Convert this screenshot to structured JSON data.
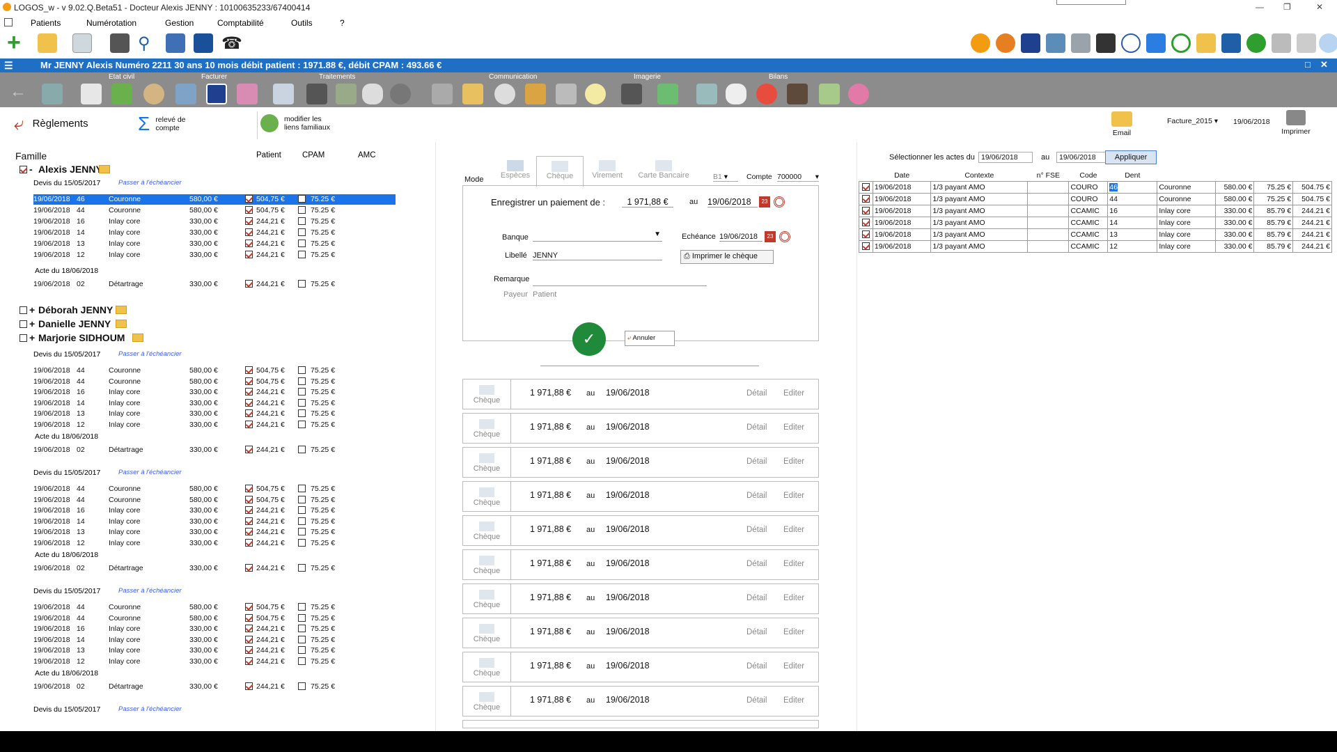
{
  "window": {
    "title": "LOGOS_w - v 9.02.Q.Beta51  -  Docteur Alexis JENNY : 10100635233/67400414"
  },
  "menu": [
    "Patients",
    "Numérotation",
    "Gestion",
    "Comptabilité",
    "Outils",
    "?"
  ],
  "patient_bar": "Mr JENNY Alexis   Numéro 2211    30 ans 10 mois   débit patient : 1971.88 €, débit CPAM : 493.66 €",
  "group_labels": {
    "etat_civil": "Etat civil",
    "facturer": "Facturer",
    "traitements": "Traitements",
    "communication": "Communication",
    "imagerie": "Imagerie",
    "bilans": "Bilans"
  },
  "actions": {
    "reglements": "Règlements",
    "releve": "relevé de compte",
    "modifier": "modifier les liens familiaux",
    "email": "Email",
    "facture_select": "Facture_2015",
    "facture_date": "19/06/2018",
    "imprimer": "Imprimer"
  },
  "left": {
    "headers": {
      "famille": "Famille",
      "patient": "Patient",
      "cpam": "CPAM",
      "amc": "AMC"
    },
    "members": [
      {
        "label": "Alexis JENNY",
        "prefix": "-"
      },
      {
        "label": "Déborah JENNY",
        "prefix": "+"
      },
      {
        "label": "Danielle JENNY",
        "prefix": "+"
      },
      {
        "label": "Marjorie SIDHOUM",
        "prefix": "+"
      }
    ],
    "devis_label": "Devis du 15/05/2017",
    "echeancier": "Passer à l'échéancier",
    "acte_label": "Acte du 18/06/2018",
    "group1_rows": [
      [
        "19/06/2018",
        "46",
        "Couronne",
        "580,00 €",
        "504,75 €",
        "75.25 €"
      ],
      [
        "19/06/2018",
        "44",
        "Couronne",
        "580,00 €",
        "504,75 €",
        "75.25 €"
      ],
      [
        "19/06/2018",
        "16",
        "Inlay core",
        "330,00 €",
        "244,21 €",
        "75.25 €"
      ],
      [
        "19/06/2018",
        "14",
        "Inlay core",
        "330,00 €",
        "244,21 €",
        "75.25 €"
      ],
      [
        "19/06/2018",
        "13",
        "Inlay core",
        "330,00 €",
        "244,21 €",
        "75.25 €"
      ],
      [
        "19/06/2018",
        "12",
        "Inlay core",
        "330,00 €",
        "244,21 €",
        "75.25 €"
      ]
    ],
    "group2_rows": [
      [
        "19/06/2018",
        "44",
        "Couronne",
        "580,00 €",
        "504,75 €",
        "75.25 €"
      ],
      [
        "19/06/2018",
        "44",
        "Couronne",
        "580,00 €",
        "504,75 €",
        "75.25 €"
      ],
      [
        "19/06/2018",
        "16",
        "Inlay core",
        "330,00 €",
        "244,21 €",
        "75.25 €"
      ],
      [
        "19/06/2018",
        "14",
        "Inlay core",
        "330,00 €",
        "244,21 €",
        "75.25 €"
      ],
      [
        "19/06/2018",
        "13",
        "Inlay core",
        "330,00 €",
        "244,21 €",
        "75.25 €"
      ],
      [
        "19/06/2018",
        "12",
        "Inlay core",
        "330,00 €",
        "244,21 €",
        "75.25 €"
      ]
    ],
    "acte_row": [
      "19/06/2018",
      "02",
      "Détartrage",
      "330,00 €",
      "244,21 €",
      "75.25 €"
    ]
  },
  "payment": {
    "tabs": [
      "Mode",
      "Espèces",
      "Chèque",
      "Virement",
      "Carte Bancaire"
    ],
    "b1": "B1",
    "compte_label": "Compte",
    "compte_value": "700000",
    "title": "Enregistrer un paiement de :",
    "amount": "1 971,88 €",
    "au": "au",
    "date": "19/06/2018",
    "banque_label": "Banque",
    "echeance_label": "Echéance",
    "echeance_value": "19/06/2018",
    "libelle_label": "Libellé",
    "libelle_value": "JENNY",
    "imprimer_cheque": "Imprimer le chèque",
    "remarque_label": "Remarque",
    "payeur_label": "Payeur",
    "payeur_value": "Patient",
    "annuler": "Annuler",
    "history": {
      "mode": "Chèque",
      "amount": "1 971,88 €",
      "au": "au",
      "date": "19/06/2018",
      "detail": "Détail",
      "editer": "Editer",
      "count": 10
    }
  },
  "right": {
    "select_label": "Sélectionner les actes du",
    "from": "19/06/2018",
    "au": "au",
    "to": "19/06/2018",
    "apply": "Appliquer",
    "columns": [
      "Date",
      "Contexte",
      "n° FSE",
      "Code",
      "Dent"
    ],
    "rows": [
      [
        "19/06/2018",
        "1/3 payant AMO",
        "",
        "COURO",
        "46",
        "Couronne",
        "580.00 €",
        "75.25 €",
        "504.75 €"
      ],
      [
        "19/06/2018",
        "1/3 payant AMO",
        "",
        "COURO",
        "44",
        "Couronne",
        "580.00 €",
        "75.25 €",
        "504.75 €"
      ],
      [
        "19/06/2018",
        "1/3 payant AMO",
        "",
        "CCAMIC",
        "16",
        "Inlay core",
        "330.00 €",
        "85.79 €",
        "244.21 €"
      ],
      [
        "19/06/2018",
        "1/3 payant AMO",
        "",
        "CCAMIC",
        "14",
        "Inlay core",
        "330.00 €",
        "85.79 €",
        "244.21 €"
      ],
      [
        "19/06/2018",
        "1/3 payant AMO",
        "",
        "CCAMIC",
        "13",
        "Inlay core",
        "330.00 €",
        "85.79 €",
        "244.21 €"
      ],
      [
        "19/06/2018",
        "1/3 payant AMO",
        "",
        "CCAMIC",
        "12",
        "Inlay core",
        "330.00 €",
        "85.79 €",
        "244.21 €"
      ]
    ]
  }
}
